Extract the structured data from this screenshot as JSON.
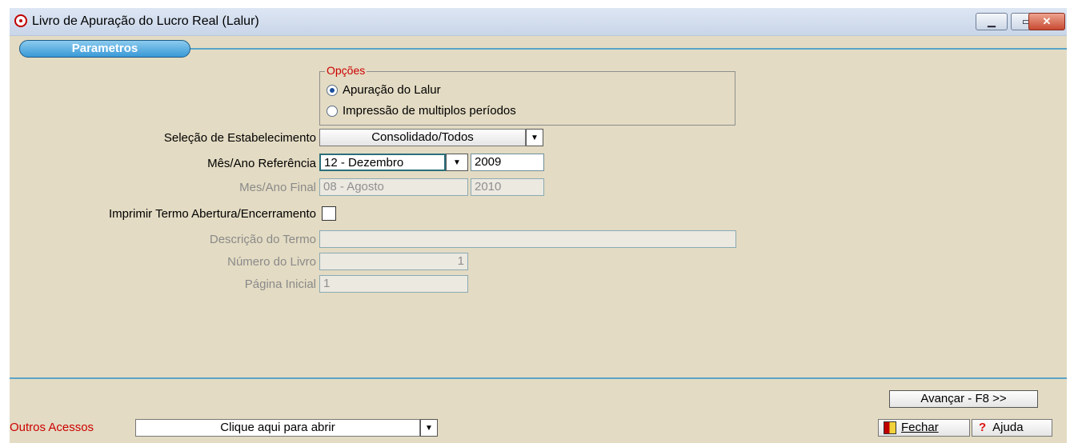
{
  "window": {
    "title": "Livro de Apuração do Lucro Real (Lalur)",
    "minimize": "▁",
    "maximize": "▭",
    "close": "✕"
  },
  "tab": {
    "label": "Parametros"
  },
  "options": {
    "legend": "Opções",
    "items": [
      {
        "label": "Apuração do Lalur",
        "selected": true
      },
      {
        "label": "Impressão de multiplos períodos",
        "selected": false
      }
    ]
  },
  "form": {
    "estabelecimento_label": "Seleção de Estabelecimento",
    "estabelecimento_value": "Consolidado/Todos",
    "mes_ano_ref_label": "Mês/Ano Referência",
    "mes_ref_value": "12 - Dezembro",
    "ano_ref_value": "2009",
    "mes_ano_final_label": "Mes/Ano Final",
    "mes_final_value": "08 - Agosto",
    "ano_final_value": "2010",
    "termo_label": "Imprimir Termo Abertura/Encerramento",
    "descricao_label": "Descrição do Termo",
    "descricao_value": "",
    "numero_livro_label": "Número do Livro",
    "numero_livro_value": "1",
    "pagina_label": "Página Inicial",
    "pagina_value": "1"
  },
  "footer": {
    "avancar_label": "Avançar - F8 >>",
    "outros_label": "Outros Acessos",
    "outros_value": "Clique aqui para abrir",
    "fechar_label": "Fechar",
    "ajuda_label": "Ajuda"
  }
}
